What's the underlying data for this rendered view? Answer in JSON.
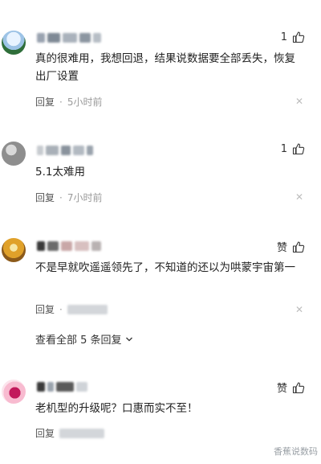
{
  "comments": [
    {
      "likes": "1",
      "text": "真的很难用，我想回退，结果说数据要全部丢失，恢复出厂设置",
      "reply_label": "回复",
      "time": "5小时前"
    },
    {
      "likes": "1",
      "text": "5.1太难用",
      "reply_label": "回复",
      "time": "7小时前"
    },
    {
      "likes": "赞",
      "text": "不是早就吹遥遥领先了，不知道的还以为哄蒙宇宙第一",
      "reply_label": "回复",
      "view_replies": "查看全部 5 条回复"
    },
    {
      "likes": "赞",
      "text": "老机型的升级呢？口惠而实不至！",
      "reply_label": "回复"
    }
  ],
  "watermark": "香蕉说数码",
  "icons": {
    "like": "thumb-up-icon",
    "close": "close-icon",
    "chevron": "chevron-down-icon"
  }
}
